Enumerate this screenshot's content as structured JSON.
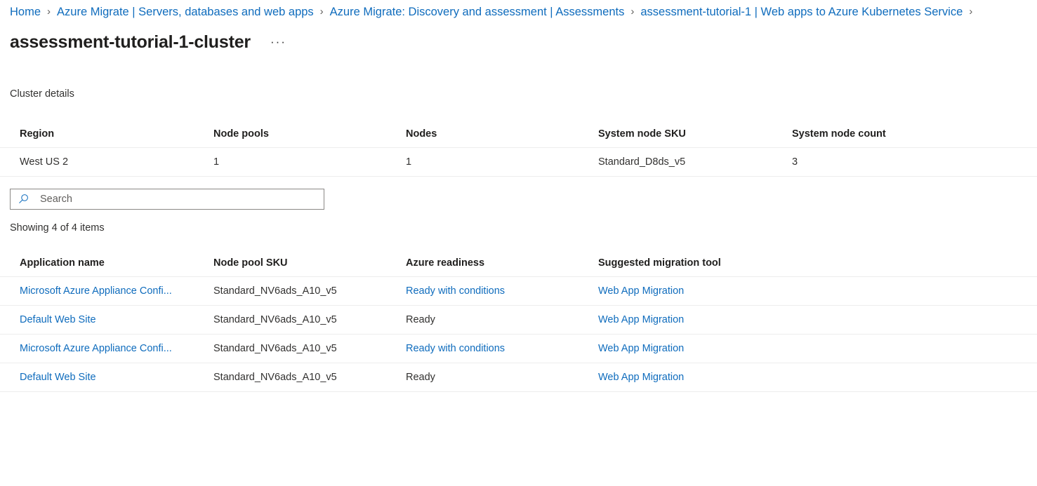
{
  "breadcrumb": {
    "separator": "›",
    "items": [
      {
        "label": "Home"
      },
      {
        "label": "Azure Migrate | Servers, databases and web apps"
      },
      {
        "label": "Azure Migrate: Discovery and assessment | Assessments"
      },
      {
        "label": "assessment-tutorial-1 | Web apps to Azure Kubernetes Service"
      }
    ]
  },
  "header": {
    "title": "assessment-tutorial-1-cluster",
    "more_label": "···"
  },
  "cluster_details": {
    "section_label": "Cluster details",
    "columns": [
      "Region",
      "Node pools",
      "Nodes",
      "System node SKU",
      "System node count"
    ],
    "rows": [
      {
        "region": "West US 2",
        "node_pools": "1",
        "nodes": "1",
        "system_node_sku": "Standard_D8ds_v5",
        "system_node_count": "3"
      }
    ]
  },
  "search": {
    "placeholder": "Search",
    "value": "",
    "icon": "search-icon"
  },
  "list": {
    "showing_text": "Showing 4 of 4 items",
    "columns": [
      "Application name",
      "Node pool SKU",
      "Azure readiness",
      "Suggested migration tool"
    ],
    "rows": [
      {
        "application_name": "Microsoft Azure Appliance Confi...",
        "application_name_is_link": true,
        "node_pool_sku": "Standard_NV6ads_A10_v5",
        "azure_readiness": "Ready with conditions",
        "azure_readiness_is_link": true,
        "suggested_migration_tool": "Web App Migration",
        "suggested_migration_tool_is_link": true
      },
      {
        "application_name": "Default Web Site",
        "application_name_is_link": true,
        "node_pool_sku": "Standard_NV6ads_A10_v5",
        "azure_readiness": "Ready",
        "azure_readiness_is_link": false,
        "suggested_migration_tool": "Web App Migration",
        "suggested_migration_tool_is_link": true
      },
      {
        "application_name": "Microsoft Azure Appliance Confi...",
        "application_name_is_link": true,
        "node_pool_sku": "Standard_NV6ads_A10_v5",
        "azure_readiness": "Ready with conditions",
        "azure_readiness_is_link": true,
        "suggested_migration_tool": "Web App Migration",
        "suggested_migration_tool_is_link": true
      },
      {
        "application_name": "Default Web Site",
        "application_name_is_link": true,
        "node_pool_sku": "Standard_NV6ads_A10_v5",
        "azure_readiness": "Ready",
        "azure_readiness_is_link": false,
        "suggested_migration_tool": "Web App Migration",
        "suggested_migration_tool_is_link": true
      }
    ]
  },
  "colors": {
    "link": "#0f6cbd",
    "text": "#323130",
    "heading": "#201f1e",
    "border": "#ededed",
    "input_border": "#8a8886",
    "background": "#ffffff"
  }
}
